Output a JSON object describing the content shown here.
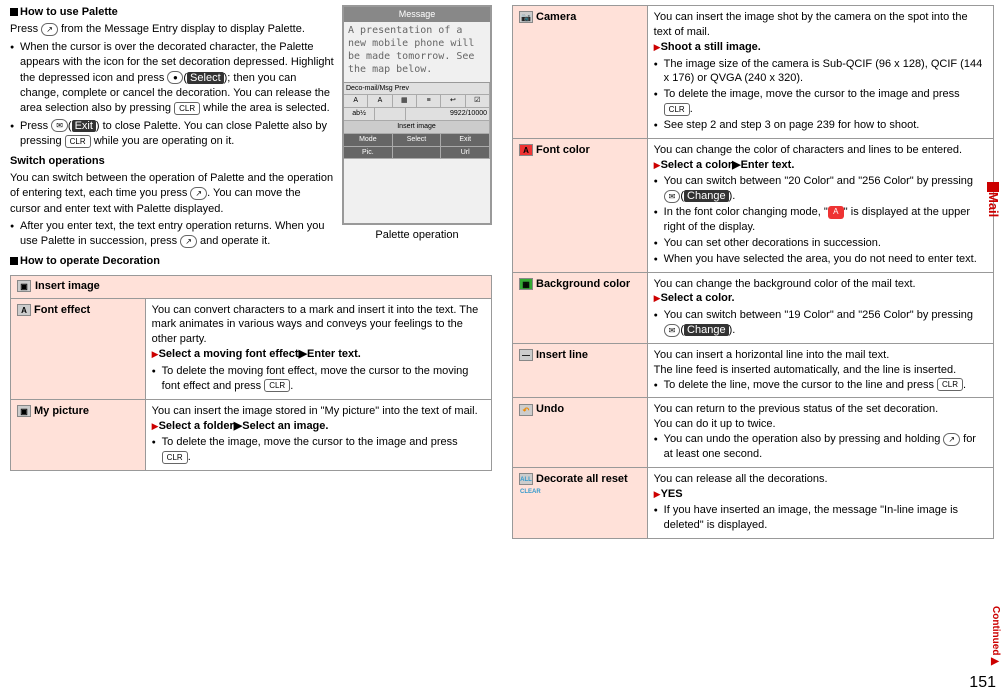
{
  "sideTab": "Mail",
  "pageNumber": "151",
  "continued": "Continued",
  "left": {
    "howToUsePalette": {
      "title": "How to use Palette",
      "line1_a": "Press ",
      "line1_b": " from the Message Entry display to display Palette.",
      "bullets": [
        {
          "t": "When the cursor is over the decorated character, the Palette appears with the icon for the set decoration depressed. Highlight the depressed icon and press ",
          "mid": "(",
          "mid2": "); then you can change, complete or cancel the decoration. You can release the area selection also by pressing ",
          "end": " while the area is selected."
        },
        {
          "t": "Press ",
          "mid": "(",
          "mid2": ") to close Palette. You can close Palette also by pressing ",
          "end": " while you are operating on it."
        }
      ],
      "iconOval": "●",
      "iconSelect": "Select",
      "iconExit": "Exit",
      "iconMail": "✉",
      "iconCLR": "CLR"
    },
    "switchOps": {
      "title": "Switch operations",
      "para": "You can switch between the operation of Palette and the operation of entering text, each time you press ",
      "para2": ". You can move the cursor and enter text with Palette displayed.",
      "bullet": "After you enter text, the text entry operation returns. When you use Palette in succession, press ",
      "bullet2": " and operate it.",
      "iconCall": "↗"
    },
    "howToOperate": {
      "title": "How to operate Decoration"
    },
    "screenshot": {
      "header": "Message",
      "body": "A presentation of a new mobile phone will be made tomorrow. See the map below.",
      "paletteBar": "Deco-mail/Msg    Prev",
      "insertLabel": "Insert image",
      "counter": "9922/10000",
      "btns": [
        "Mode",
        "Select",
        "Exit",
        "Pic.",
        "",
        "Url"
      ],
      "caption": "Palette operation"
    },
    "table": {
      "header": "Insert image",
      "rows": [
        {
          "label": "Font effect",
          "desc": "You can convert characters to a mark and insert it into the text. The mark animates in various ways and conveys your feelings to the other party.",
          "step": "Select a moving font effect▶Enter text.",
          "bullets": [
            "To delete the moving font effect, move the cursor to the moving font effect and press "
          ],
          "iconCLR": "CLR"
        },
        {
          "label": "My picture",
          "desc": "You can insert the image stored in \"My picture\" into the text of mail.",
          "step": "Select a folder▶Select an image.",
          "bullets": [
            "To delete the image, move the cursor to the image and press "
          ],
          "iconCLR": "CLR"
        }
      ]
    }
  },
  "right": {
    "rows": [
      {
        "label": "Camera",
        "desc": "You can insert the image shot by the camera on the spot into the text of mail.",
        "step": "Shoot a still image.",
        "bullets": [
          "The image size of the camera is Sub-QCIF (96 x 128), QCIF (144 x 176) or QVGA (240 x 320).",
          "To delete the image, move the cursor to the image and press ",
          "See step 2 and step 3 on page 239 for how to shoot."
        ],
        "iconCLR": "CLR",
        "clrAt": 1
      },
      {
        "label": "Font color",
        "desc": "You can change the color of characters and lines to be entered.",
        "step": "Select a color▶Enter text.",
        "bullets": [
          "You can switch between \"20 Color\" and \"256 Color\" by pressing ",
          "In the font color changing mode, \"   \" is displayed at the upper right of the display.",
          "You can set other decorations in succession.",
          "When you have selected the area, you do not need to enter text."
        ],
        "iconMail": "✉",
        "iconChange": "Change",
        "iconA": "A",
        "mailAt": 0,
        "aAt": 1
      },
      {
        "label": "Background color",
        "desc": "You can change the background color of the mail text.",
        "step": "Select a color.",
        "bullets": [
          "You can switch between \"19 Color\" and \"256 Color\" by pressing "
        ],
        "iconMail": "✉",
        "iconChange": "Change",
        "mailAt": 0
      },
      {
        "label": "Insert line",
        "desc": "You can insert a horizontal line into the mail text.",
        "desc2": "The line feed is inserted automatically, and the line is inserted.",
        "bullets": [
          "To delete the line, move the cursor to the line and press "
        ],
        "iconCLR": "CLR",
        "clrAt": 0
      },
      {
        "label": "Undo",
        "desc": "You can return to the previous status of the set decoration.",
        "desc2": "You can do it up to twice.",
        "bullets": [
          "You can undo the operation also by pressing and holding  for at least one second."
        ],
        "iconCall": "↗",
        "callAt": 0
      },
      {
        "label": "Decorate all reset",
        "desc": "You can release all the decorations.",
        "step": "YES",
        "bullets": [
          "If you have inserted an image, the message \"In-line image is deleted\" is displayed."
        ]
      }
    ]
  }
}
